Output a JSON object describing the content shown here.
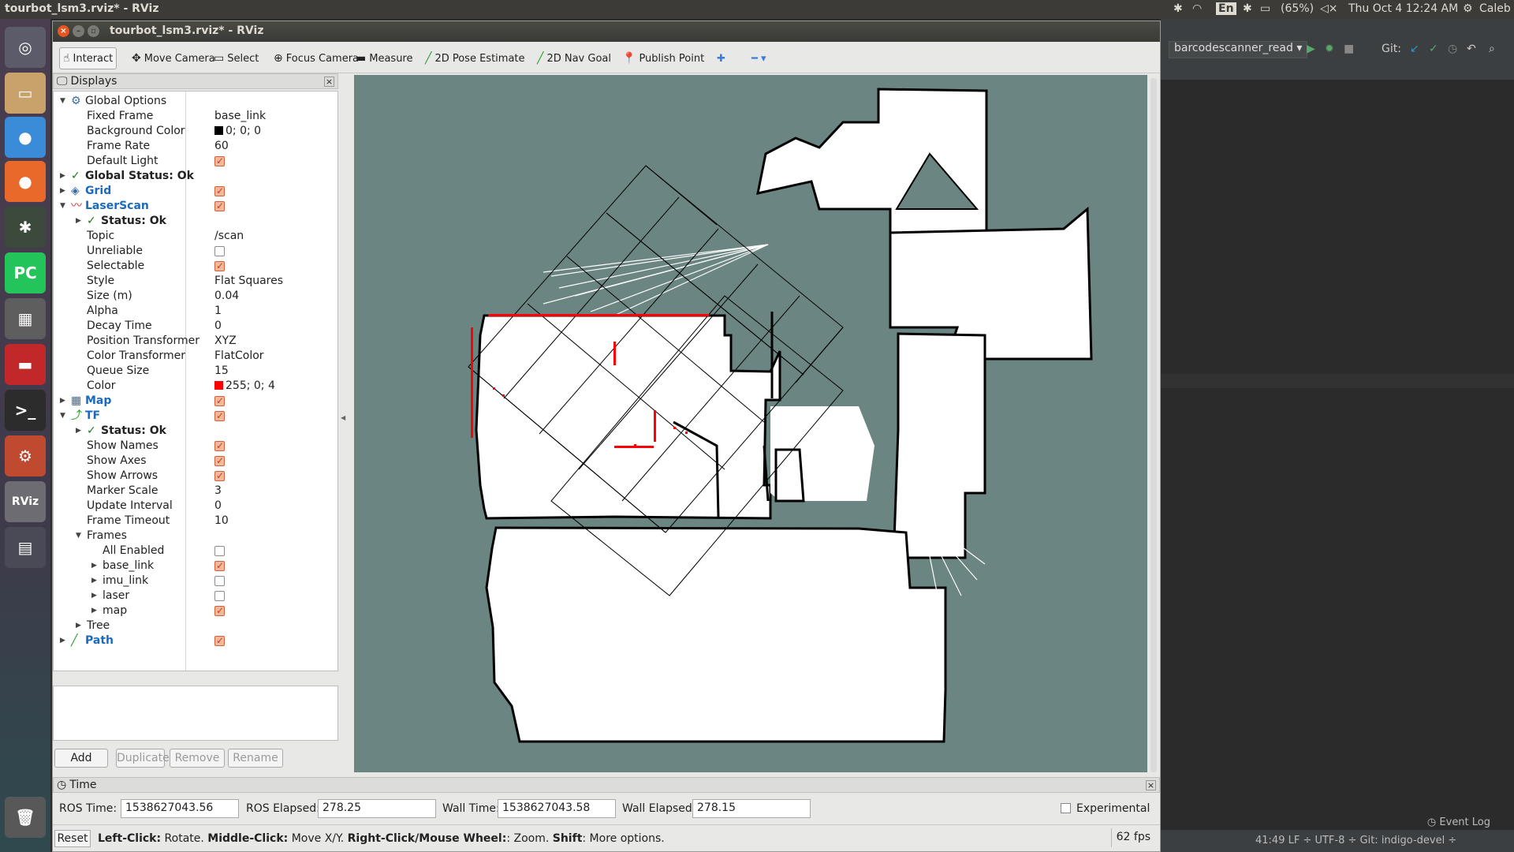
{
  "topbar": {
    "window_title": "tourbot_lsm3.rviz* - RViz",
    "keyboard": "En",
    "battery": "(65%)",
    "clock": "Thu Oct  4 12:24 AM",
    "user": "Caleb"
  },
  "launcher": {
    "items": [
      {
        "name": "ubuntu-dash-icon",
        "glyph": "◎",
        "color": "#5b5b6a"
      },
      {
        "name": "files-icon",
        "glyph": "▭",
        "color": "#c8a26a"
      },
      {
        "name": "chrome-icon",
        "glyph": "●",
        "color": "#3a8bd8"
      },
      {
        "name": "firefox-icon",
        "glyph": "●",
        "color": "#e8692a"
      },
      {
        "name": "inkscape-icon",
        "glyph": "✱",
        "color": "#3b4a3a"
      },
      {
        "name": "pycharm-icon",
        "glyph": "PC",
        "color": "#23c45a"
      },
      {
        "name": "calculator-icon",
        "glyph": "▦",
        "color": "#5e5e5e"
      },
      {
        "name": "app-red-icon",
        "glyph": "▬",
        "color": "#c0282a"
      },
      {
        "name": "terminal-icon",
        "glyph": ">_",
        "color": "#2c2c2c"
      },
      {
        "name": "settings-icon",
        "glyph": "⚙",
        "color": "#c04a30"
      },
      {
        "name": "rviz-icon",
        "glyph": "RViz",
        "color": "#6c6c72"
      },
      {
        "name": "workspace-icon",
        "glyph": "▤",
        "color": "#4a4a56"
      },
      {
        "name": "trash-icon",
        "glyph": "🗑",
        "color": "#585858"
      }
    ]
  },
  "ide": {
    "run_config": "barcodescanner_read",
    "git_label": "Git:",
    "event_log": "Event Log",
    "status": "41:49   LF ÷   UTF-8 ÷   Git: indigo-devel ÷"
  },
  "window": {
    "title": "tourbot_lsm3.rviz* - RViz"
  },
  "toolbar": {
    "tools": [
      {
        "label": "Interact",
        "icon": "hand-icon",
        "glyph": "☝",
        "active": true
      },
      {
        "label": "Move Camera",
        "icon": "move-camera-icon",
        "glyph": "✥",
        "active": false
      },
      {
        "label": "Select",
        "icon": "select-icon",
        "glyph": "▭",
        "active": false
      },
      {
        "label": "Focus Camera",
        "icon": "focus-camera-icon",
        "glyph": "⊕",
        "active": false
      },
      {
        "label": "Measure",
        "icon": "measure-icon",
        "glyph": "▬",
        "active": false
      },
      {
        "label": "2D Pose Estimate",
        "icon": "pose-estimate-icon",
        "glyph": "╱",
        "active": false
      },
      {
        "label": "2D Nav Goal",
        "icon": "nav-goal-icon",
        "glyph": "╱",
        "active": false
      },
      {
        "label": "Publish Point",
        "icon": "publish-point-icon",
        "glyph": "📍",
        "active": false
      }
    ],
    "add_tool_glyph": "✚",
    "remove_tool_glyph": "━"
  },
  "displays_panel": {
    "title": "Displays",
    "rows": [
      {
        "level": 0,
        "expand": "down",
        "icon": "⚙",
        "label": "Global Options",
        "style": "",
        "value": ""
      },
      {
        "level": 1,
        "label": "Fixed Frame",
        "value": "base_link"
      },
      {
        "level": 1,
        "label": "Background Color",
        "value": "0; 0; 0",
        "swatch": "#000000"
      },
      {
        "level": 1,
        "label": "Frame Rate",
        "value": "60"
      },
      {
        "level": 1,
        "label": "Default Light",
        "check": true
      },
      {
        "level": 0,
        "expand": "right",
        "ok": true,
        "label": "Global Status: Ok",
        "style": "bold"
      },
      {
        "level": 0,
        "expand": "right",
        "icon": "◈",
        "label": "Grid",
        "style": "blue",
        "check": true
      },
      {
        "level": 0,
        "expand": "down",
        "icon": "〰",
        "label": "LaserScan",
        "style": "blue",
        "check": true
      },
      {
        "level": 1,
        "expand": "right",
        "ok": true,
        "label": "Status: Ok"
      },
      {
        "level": 1,
        "label": "Topic",
        "value": "/scan"
      },
      {
        "level": 1,
        "label": "Unreliable",
        "check": false
      },
      {
        "level": 1,
        "label": "Selectable",
        "check": true
      },
      {
        "level": 1,
        "label": "Style",
        "value": "Flat Squares"
      },
      {
        "level": 1,
        "label": "Size (m)",
        "value": "0.04"
      },
      {
        "level": 1,
        "label": "Alpha",
        "value": "1"
      },
      {
        "level": 1,
        "label": "Decay Time",
        "value": "0"
      },
      {
        "level": 1,
        "label": "Position Transformer",
        "value": "XYZ"
      },
      {
        "level": 1,
        "label": "Color Transformer",
        "value": "FlatColor"
      },
      {
        "level": 1,
        "label": "Queue Size",
        "value": "15"
      },
      {
        "level": 1,
        "label": "Color",
        "value": "255; 0; 4",
        "swatch": "#ff0004"
      },
      {
        "level": 0,
        "expand": "right",
        "icon": "▦",
        "label": "Map",
        "style": "blue",
        "check": true
      },
      {
        "level": 0,
        "expand": "down",
        "icon": "⤴",
        "label": "TF",
        "style": "blue",
        "check": true
      },
      {
        "level": 1,
        "expand": "right",
        "ok": true,
        "label": "Status: Ok"
      },
      {
        "level": 1,
        "label": "Show Names",
        "check": true
      },
      {
        "level": 1,
        "label": "Show Axes",
        "check": true
      },
      {
        "level": 1,
        "label": "Show Arrows",
        "check": true
      },
      {
        "level": 1,
        "label": "Marker Scale",
        "value": "3"
      },
      {
        "level": 1,
        "label": "Update Interval",
        "value": "0"
      },
      {
        "level": 1,
        "label": "Frame Timeout",
        "value": "10"
      },
      {
        "level": 1,
        "expand": "down",
        "label": "Frames"
      },
      {
        "level": 2,
        "label": "All Enabled",
        "check": false
      },
      {
        "level": 2,
        "expand": "right",
        "label": "base_link",
        "check": true
      },
      {
        "level": 2,
        "expand": "right",
        "label": "imu_link",
        "check": false
      },
      {
        "level": 2,
        "expand": "right",
        "label": "laser",
        "check": false
      },
      {
        "level": 2,
        "expand": "right",
        "label": "map",
        "check": true
      },
      {
        "level": 1,
        "expand": "right",
        "label": "Tree"
      },
      {
        "level": 0,
        "expand": "right",
        "icon": "╱",
        "label": "Path",
        "style": "blue",
        "check": true
      }
    ],
    "buttons": [
      {
        "label": "Add",
        "enabled": true
      },
      {
        "label": "Duplicate",
        "enabled": false
      },
      {
        "label": "Remove",
        "enabled": false
      },
      {
        "label": "Rename",
        "enabled": false
      }
    ]
  },
  "time_panel": {
    "title": "Time",
    "ros_time_label": "ROS Time:",
    "ros_time": "1538627043.56",
    "ros_elapsed_label": "ROS Elapsed:",
    "ros_elapsed": "278.25",
    "wall_time_label": "Wall Time:",
    "wall_time": "1538627043.58",
    "wall_elapsed_label": "Wall Elapsed:",
    "wall_elapsed": "278.15",
    "experimental_label": "Experimental"
  },
  "status": {
    "reset_label": "Reset",
    "help_parts": [
      {
        "text": "Left-Click:",
        "bold": true
      },
      {
        "text": " Rotate. ",
        "bold": false
      },
      {
        "text": "Middle-Click:",
        "bold": true
      },
      {
        "text": " Move X/Y. ",
        "bold": false
      },
      {
        "text": "Right-Click/Mouse Wheel:",
        "bold": true
      },
      {
        "text": ": Zoom. ",
        "bold": false
      },
      {
        "text": "Shift",
        "bold": true
      },
      {
        "text": ": More options.",
        "bold": false
      }
    ],
    "fps": "62 fps"
  },
  "view": {
    "background_color": "#6b8582",
    "map_free_color": "#ffffff",
    "map_wall_color": "#000000",
    "scan_color": "#ff0004"
  }
}
